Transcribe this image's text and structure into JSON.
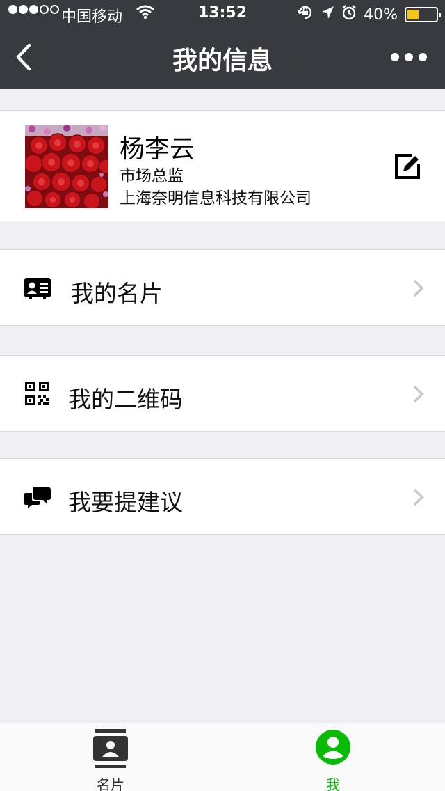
{
  "status_bar": {
    "carrier": "中国移动",
    "time": "13:52",
    "battery": "40%",
    "battery_level": 0.4,
    "signal_strength": 3,
    "battery_color": "#f5c518"
  },
  "nav": {
    "title": "我的信息",
    "back_icon": "back-chevron-icon",
    "more_icon": "more-dots-icon"
  },
  "profile": {
    "name": "杨李云",
    "title": "市场总监",
    "company": "上海奈明信息科技有限公司",
    "avatar": "red-roses-photo",
    "edit_icon": "edit-icon"
  },
  "menu": [
    {
      "label": "我的名片",
      "icon": "business-card-icon"
    },
    {
      "label": "我的二维码",
      "icon": "qr-code-icon"
    },
    {
      "label": "我要提建议",
      "icon": "feedback-chat-icon"
    }
  ],
  "tabs": [
    {
      "label": "名片",
      "icon": "contacts-card-icon",
      "active": false,
      "color": "#333333"
    },
    {
      "label": "我",
      "icon": "profile-icon",
      "active": true,
      "color": "#09bb07"
    }
  ],
  "colors": {
    "nav_background": "#393a3f",
    "page_background": "#efeff4",
    "accent_green": "#09bb07"
  }
}
